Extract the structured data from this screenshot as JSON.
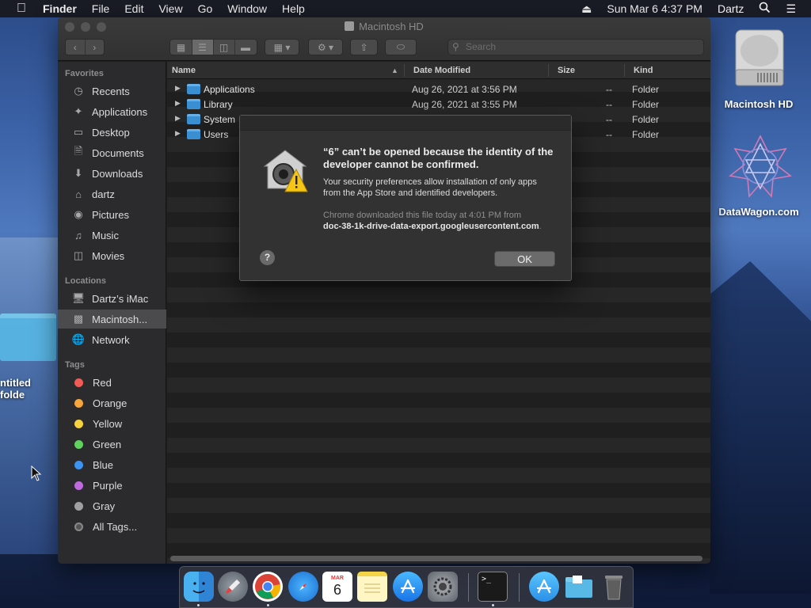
{
  "menubar": {
    "apple_icon": "apple-icon",
    "app_name": "Finder",
    "items": [
      "File",
      "Edit",
      "View",
      "Go",
      "Window",
      "Help"
    ],
    "datetime": "Sun Mar 6  4:37 PM",
    "user": "Dartz"
  },
  "window": {
    "title": "Macintosh HD",
    "search_placeholder": "Search"
  },
  "sidebar": {
    "favorites_header": "Favorites",
    "favorites": [
      {
        "label": "Recents",
        "icon": "clock-icon"
      },
      {
        "label": "Applications",
        "icon": "applications-icon"
      },
      {
        "label": "Desktop",
        "icon": "desktop-icon"
      },
      {
        "label": "Documents",
        "icon": "document-icon"
      },
      {
        "label": "Downloads",
        "icon": "download-icon"
      },
      {
        "label": "dartz",
        "icon": "home-icon"
      },
      {
        "label": "Pictures",
        "icon": "camera-icon"
      },
      {
        "label": "Music",
        "icon": "music-icon"
      },
      {
        "label": "Movies",
        "icon": "film-icon"
      }
    ],
    "locations_header": "Locations",
    "locations": [
      {
        "label": "Dartz’s iMac",
        "icon": "imac-icon"
      },
      {
        "label": "Macintosh...",
        "icon": "disk-icon"
      },
      {
        "label": "Network",
        "icon": "network-icon"
      }
    ],
    "tags_header": "Tags",
    "tags": [
      {
        "label": "Red",
        "color": "#f25b55"
      },
      {
        "label": "Orange",
        "color": "#f7a43a"
      },
      {
        "label": "Yellow",
        "color": "#f6d33c"
      },
      {
        "label": "Green",
        "color": "#5fd35d"
      },
      {
        "label": "Blue",
        "color": "#3c93f2"
      },
      {
        "label": "Purple",
        "color": "#c06ae0"
      },
      {
        "label": "Gray",
        "color": "#a0a0a0"
      }
    ],
    "all_tags": "All Tags..."
  },
  "list": {
    "columns": {
      "name": "Name",
      "date": "Date Modified",
      "size": "Size",
      "kind": "Kind"
    },
    "rows": [
      {
        "name": "Applications",
        "date": "Aug 26, 2021 at 3:56 PM",
        "size": "--",
        "kind": "Folder"
      },
      {
        "name": "Library",
        "date": "Aug 26, 2021 at 3:55 PM",
        "size": "--",
        "kind": "Folder"
      },
      {
        "name": "System",
        "date": "",
        "size": "--",
        "kind": "Folder"
      },
      {
        "name": "Users",
        "date": "",
        "size": "--",
        "kind": "Folder"
      }
    ]
  },
  "dialog": {
    "title": "“6” can’t be opened because the identity of the developer cannot be confirmed.",
    "message": "Your security preferences allow installation of only apps from the App Store and identified developers.",
    "source_prefix": "Chrome downloaded this file today at 4:01 PM from",
    "source_url": "doc-38-1k-drive-data-export.googleusercontent.com",
    "source_suffix": ".",
    "help_label": "?",
    "ok_label": "OK"
  },
  "desktop": {
    "hd_label": "Macintosh HD",
    "datawagon_label": "DataWagon.com",
    "folder_label": "ntitled folde"
  },
  "dock": {
    "items": [
      "finder-icon",
      "launchpad-icon",
      "chrome-icon",
      "safari-icon",
      "calendar-icon",
      "notes-icon",
      "app-store-icon",
      "system-preferences-icon",
      "terminal-icon",
      "applications-folder-icon",
      "downloads-folder-icon",
      "trash-icon"
    ],
    "calendar_month": "MAR",
    "calendar_day": "6"
  }
}
